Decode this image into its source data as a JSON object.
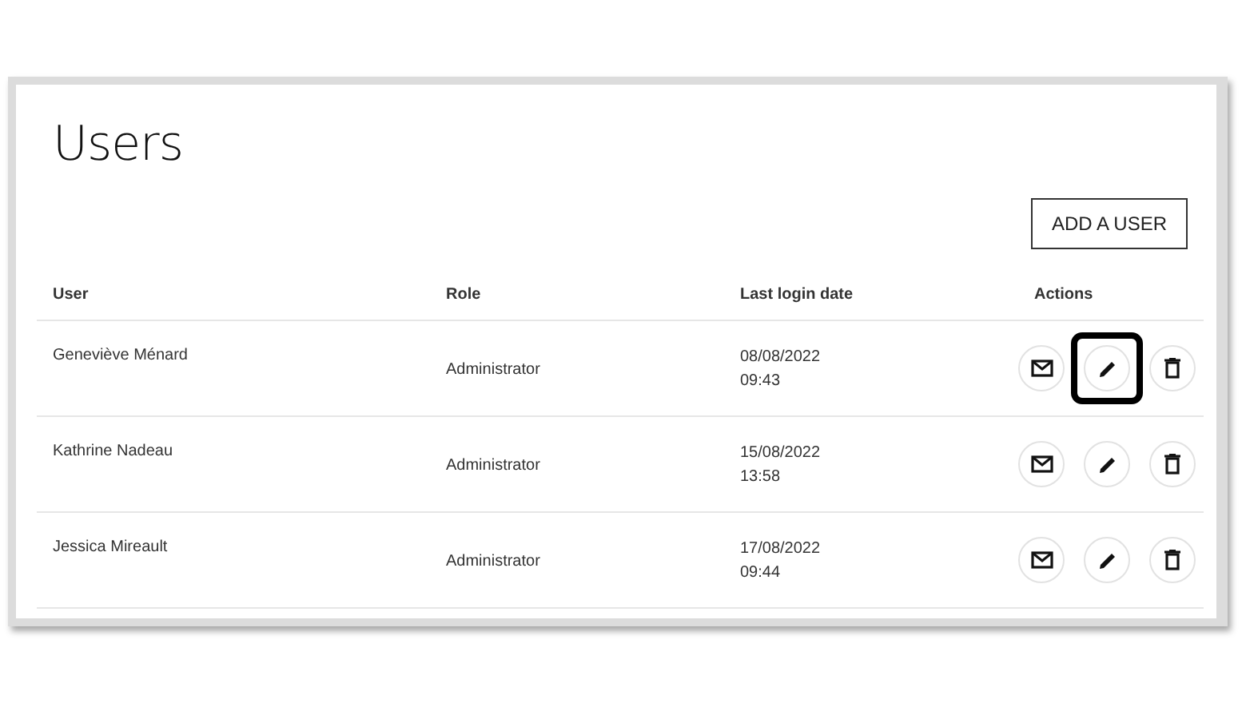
{
  "title": "Users",
  "add_button": "ADD A USER",
  "table": {
    "columns": [
      "User",
      "Role",
      "Last login date",
      "Actions"
    ],
    "rows": [
      {
        "user": "Geneviève Ménard",
        "role": "Administrator",
        "date": "08/08/2022",
        "time": "09:43",
        "actions": [
          {
            "kind": "mail",
            "highlighted": false
          },
          {
            "kind": "edit",
            "highlighted": true
          },
          {
            "kind": "delete",
            "highlighted": false
          }
        ]
      },
      {
        "user": "Kathrine Nadeau",
        "role": "Administrator",
        "date": "15/08/2022",
        "time": "13:58",
        "actions": [
          {
            "kind": "mail",
            "highlighted": false
          },
          {
            "kind": "edit",
            "highlighted": false
          },
          {
            "kind": "delete",
            "highlighted": false
          }
        ]
      },
      {
        "user": "Jessica Mireault",
        "role": "Administrator",
        "date": "17/08/2022",
        "time": "09:44",
        "actions": [
          {
            "kind": "mail",
            "highlighted": false
          },
          {
            "kind": "edit",
            "highlighted": false
          },
          {
            "kind": "delete",
            "highlighted": false
          }
        ]
      }
    ]
  }
}
